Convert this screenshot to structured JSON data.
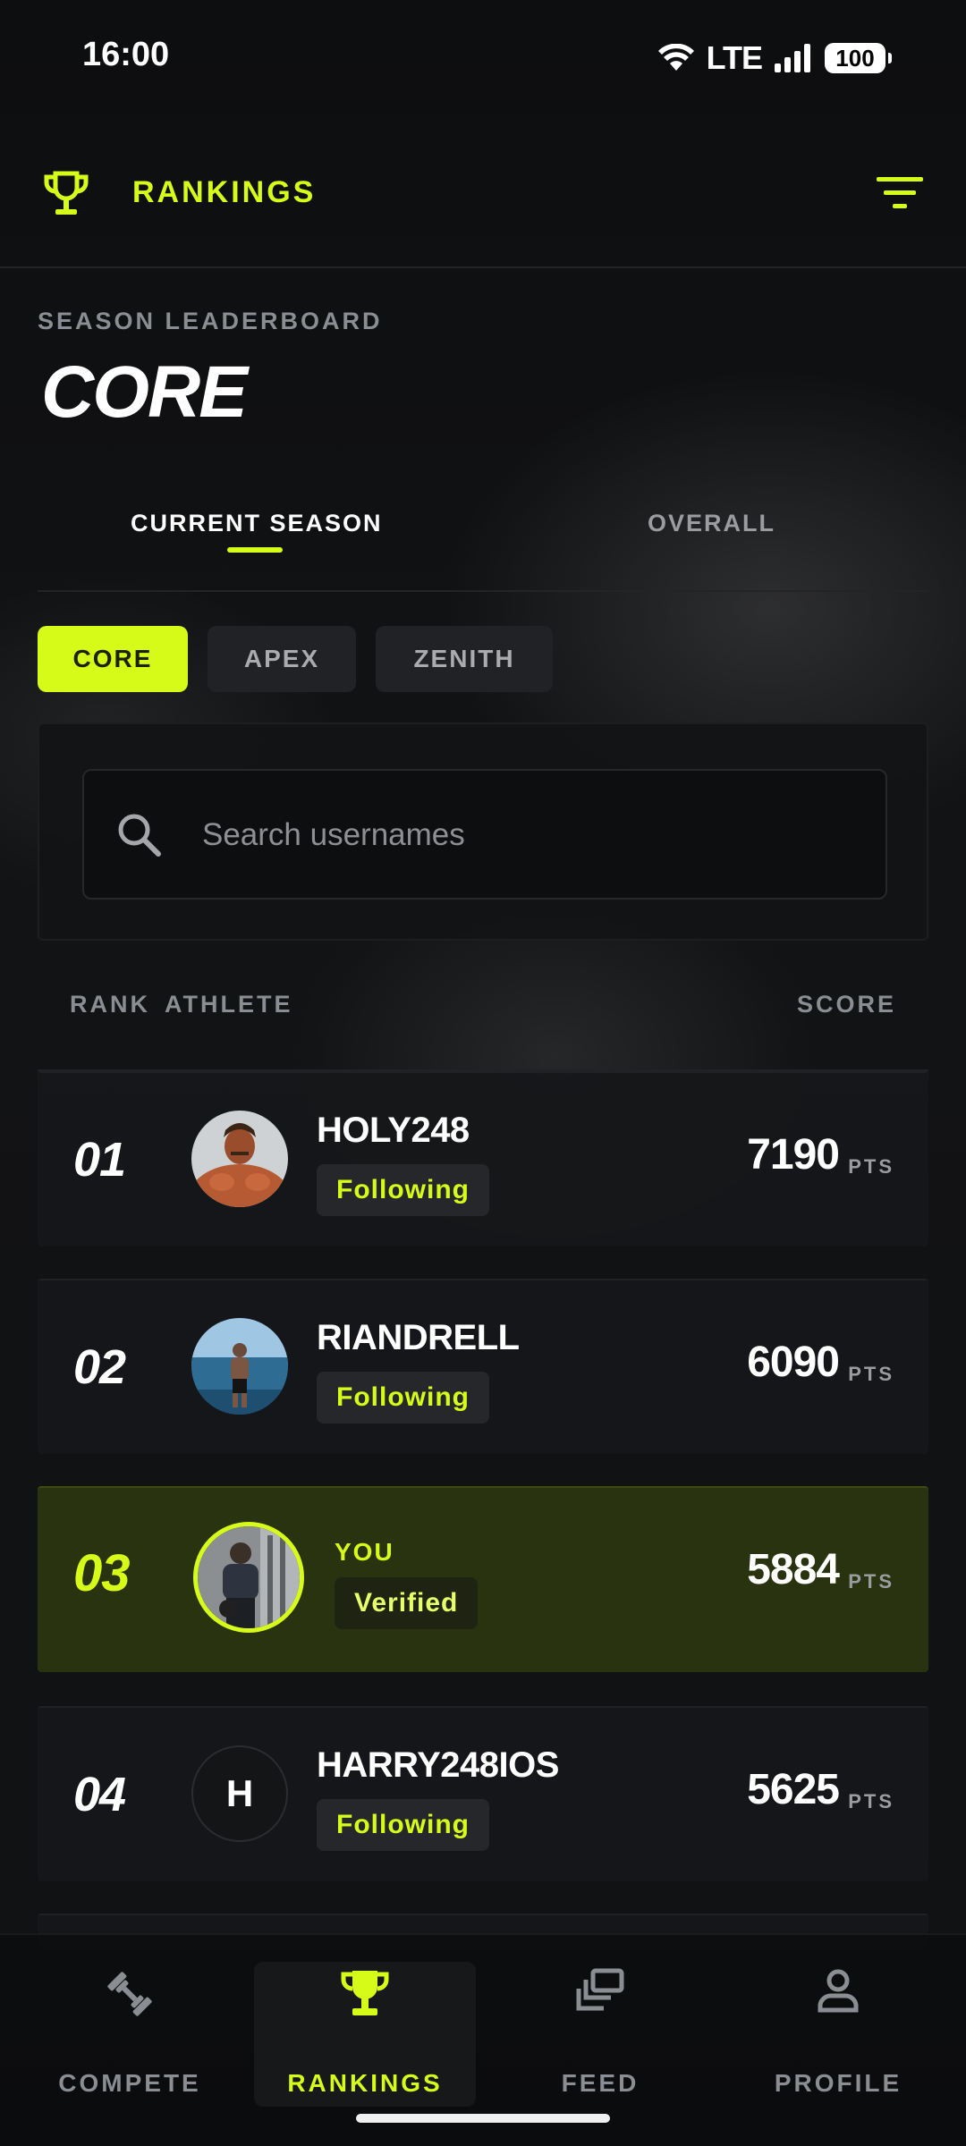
{
  "status_bar": {
    "time": "16:00",
    "network": "LTE",
    "battery": "100"
  },
  "header": {
    "title": "RANKINGS",
    "icon": "trophy-icon",
    "menu_icon": "filter-icon"
  },
  "leaderboard": {
    "eyebrow": "SEASON LEADERBOARD",
    "title": "CORE"
  },
  "tabs": [
    {
      "label": "CURRENT SEASON",
      "active": true
    },
    {
      "label": "OVERALL",
      "active": false
    }
  ],
  "leagues": [
    {
      "label": "CORE",
      "active": true
    },
    {
      "label": "APEX",
      "active": false
    },
    {
      "label": "ZENITH",
      "active": false
    }
  ],
  "search": {
    "placeholder": "Search usernames",
    "value": ""
  },
  "columns": {
    "rank": "RANK",
    "athlete": "ATHLETE",
    "score": "SCORE"
  },
  "rows": [
    {
      "rank": "01",
      "username": "HOLY248",
      "badge": "Following",
      "score": "7190",
      "unit": "PTS"
    },
    {
      "rank": "02",
      "username": "RIANDRELL",
      "badge": "Following",
      "score": "6090",
      "unit": "PTS"
    },
    {
      "rank": "03",
      "username": "YOU",
      "badge": "Verified",
      "score": "5884",
      "unit": "PTS",
      "is_current_user": true
    },
    {
      "rank": "04",
      "username": "HARRY248IOS",
      "badge": "Following",
      "score": "5625",
      "unit": "PTS",
      "avatar_initial": "H"
    }
  ],
  "nav": [
    {
      "label": "COMPETE",
      "icon": "dumbbell-icon",
      "active": false
    },
    {
      "label": "RANKINGS",
      "icon": "trophy-icon",
      "active": true
    },
    {
      "label": "FEED",
      "icon": "stack-icon",
      "active": false
    },
    {
      "label": "PROFILE",
      "icon": "person-icon",
      "active": false
    }
  ],
  "colors": {
    "accent": "#d6fb18",
    "background": "#0b0c0d",
    "highlight_row": "#2a3310"
  }
}
